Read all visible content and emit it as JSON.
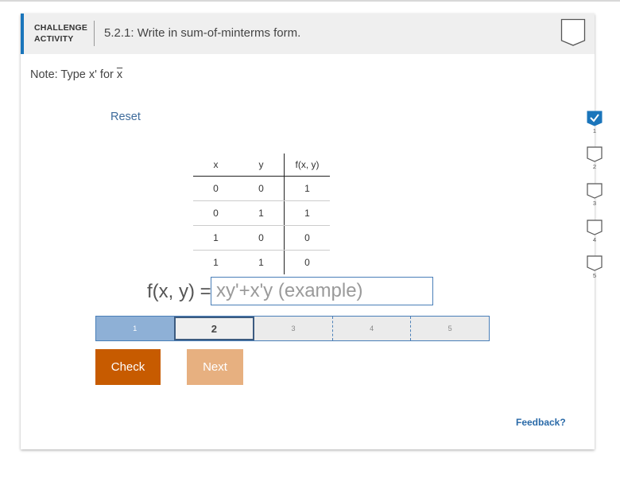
{
  "header": {
    "activity_type_line1": "CHALLENGE",
    "activity_type_line2": "ACTIVITY",
    "title": "5.2.1: Write in sum-of-minterms form."
  },
  "note": {
    "prefix": "Note: Type x' for ",
    "overlined": "x"
  },
  "reset_label": "Reset",
  "truth_table": {
    "headers": [
      "x",
      "y",
      "f(x, y)"
    ],
    "rows": [
      [
        "0",
        "0",
        "1"
      ],
      [
        "0",
        "1",
        "1"
      ],
      [
        "1",
        "0",
        "0"
      ],
      [
        "1",
        "1",
        "0"
      ]
    ]
  },
  "equation": {
    "lhs": "f(x, y) =",
    "input_value": "",
    "input_placeholder": "xy'+x'y (example)"
  },
  "progress": {
    "segments": [
      "1",
      "2",
      "3",
      "4",
      "5"
    ],
    "completed": 1,
    "current": 2
  },
  "buttons": {
    "check": "Check",
    "next": "Next"
  },
  "feedback_label": "Feedback?",
  "level_indicators": [
    {
      "number": "1",
      "completed": true
    },
    {
      "number": "2",
      "completed": false
    },
    {
      "number": "3",
      "completed": false
    },
    {
      "number": "4",
      "completed": false
    },
    {
      "number": "5",
      "completed": false
    }
  ],
  "icons": {
    "header_badge": "bookmark-badge-icon",
    "level_done": "check-badge-icon",
    "level_pending": "empty-badge-icon"
  },
  "colors": {
    "accent": "#1a75bb",
    "check_button": "#c75b00",
    "next_button_disabled": "#e7b080",
    "progress_done": "#8eb0d6",
    "progress_current_border": "#3c5b80",
    "feedback_link": "#2a6aa8",
    "level_done_fill": "#1a75bb"
  }
}
